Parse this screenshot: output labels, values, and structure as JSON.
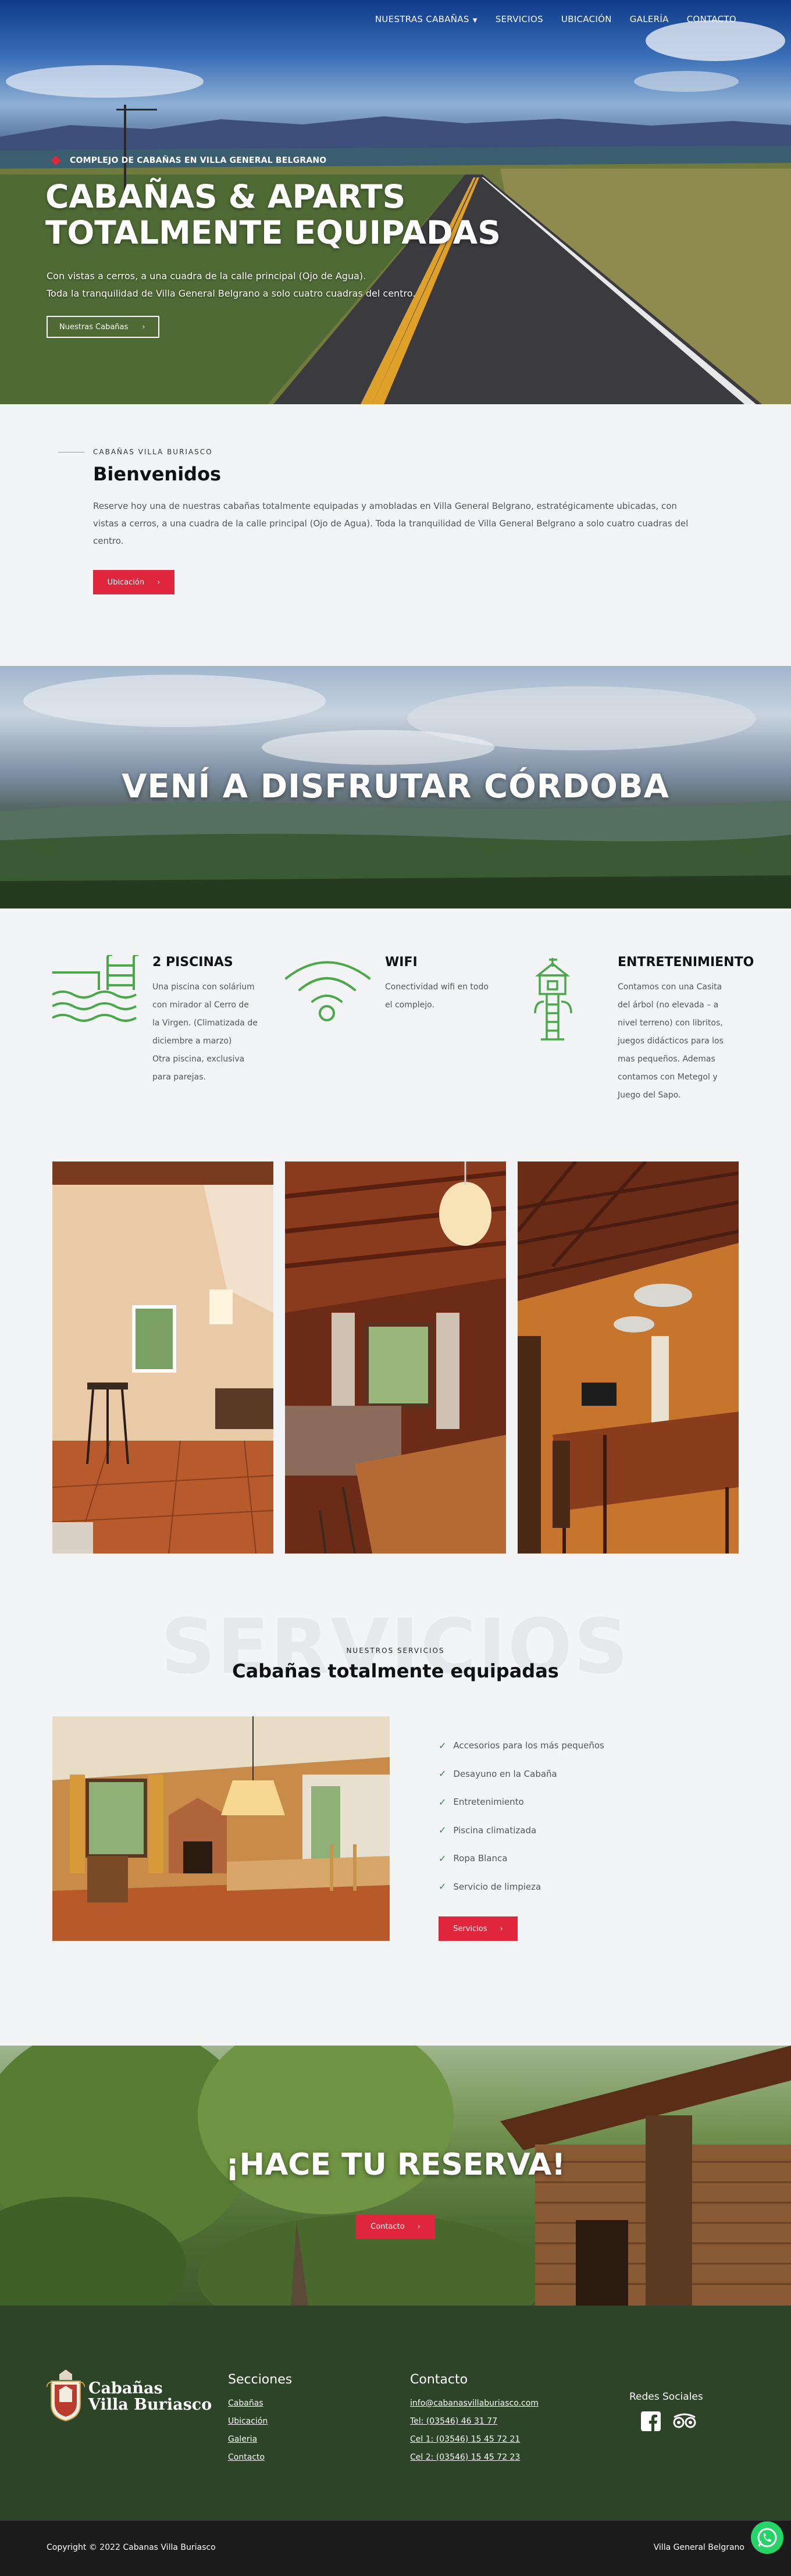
{
  "nav": {
    "items": [
      {
        "label": "NUESTRAS CABAÑAS",
        "has_dropdown": true
      },
      {
        "label": "SERVICIOS"
      },
      {
        "label": "UBICACIÓN"
      },
      {
        "label": "GALERÍA"
      },
      {
        "label": "CONTACTO"
      }
    ]
  },
  "hero": {
    "kicker": "COMPLEJO DE CABAÑAS EN VILLA GENERAL BELGRANO",
    "title_line1": "CABAÑAS & APARTS",
    "title_line2": "TOTALMENTE EQUIPADAS",
    "sub_line1": "Con vistas a cerros, a una cuadra de la calle principal (Ojo de Agua).",
    "sub_line2": "Toda la tranquilidad de Villa General Belgrano a solo cuatro cuadras del centro.",
    "cta_label": "Nuestras Cabañas"
  },
  "welcome": {
    "kicker": "CABAÑAS VILLA BURIASCO",
    "title": "Bienvenidos",
    "text": "Reserve hoy una de nuestras cabañas totalmente equipadas y amobladas en Villa General Belgrano, estratégicamente ubicadas, con vistas a cerros, a una cuadra de la calle principal (Ojo de Agua). Toda la tranquilidad de Villa General Belgrano a solo cuatro cuadras del centro.",
    "button_label": "Ubicación"
  },
  "banner": {
    "title": "VENÍ A DISFRUTAR CÓRDOBA"
  },
  "features": [
    {
      "icon": "pool-icon",
      "title": "2 PISCINAS",
      "lines": [
        "Una piscina con solárium",
        "con mirador al Cerro de",
        "la Virgen. (Climatizada de",
        "diciembre a marzo)",
        "Otra piscina, exclusiva",
        "para parejas."
      ]
    },
    {
      "icon": "wifi-icon",
      "title": "WIFI",
      "lines": [
        "Conectividad wifi en todo",
        "el complejo."
      ]
    },
    {
      "icon": "treehouse-icon",
      "title": "ENTRETENIMIENTO",
      "lines": [
        "Contamos con una Casita",
        "del árbol (no elevada – a",
        "nivel terreno) con libritos,",
        "juegos didácticos para los",
        "mas pequeños. Ademas",
        "contamos con Metegol y",
        "Juego del Sapo."
      ]
    }
  ],
  "servicios": {
    "ghost": "SERVICIOS",
    "kicker": "NUESTROS SERVICIOS",
    "title": "Cabañas totalmente equipadas",
    "items": [
      "Accesorios para los más pequeños",
      "Desayuno en la Cabaña",
      "Entretenimiento",
      "Piscina climatizada",
      "Ropa Blanca",
      "Servicio de limpieza"
    ],
    "button_label": "Servicios"
  },
  "reserva": {
    "title": "¡HACE TU RESERVA!",
    "button_label": "Contacto"
  },
  "footer": {
    "logo_line1": "Cabañas",
    "logo_line2": "Villa Buriasco",
    "secciones_title": "Secciones",
    "secciones": [
      "Cabañas",
      "Ubicación",
      "Galeria",
      "Contacto"
    ],
    "contacto_title": "Contacto",
    "contacto": [
      "info@cabanasvillaburiasco.com",
      "Tel: (03546) 46 31 77",
      "Cel 1: (03546) 15 45 72 21",
      "Cel 2: (03546) 15 45 72 23"
    ],
    "redes_title": "Redes Sociales",
    "redes": [
      "facebook-icon",
      "tripadvisor-icon"
    ],
    "copyright": "Copyright © 2022 Cabanas Villa Buriasco",
    "place": "Villa General Belgrano"
  },
  "colors": {
    "accent_red": "#e0263c",
    "green_icon": "#4aa84a",
    "footer_green": "#2d4428",
    "bottom_bar": "#1b1c1b"
  }
}
